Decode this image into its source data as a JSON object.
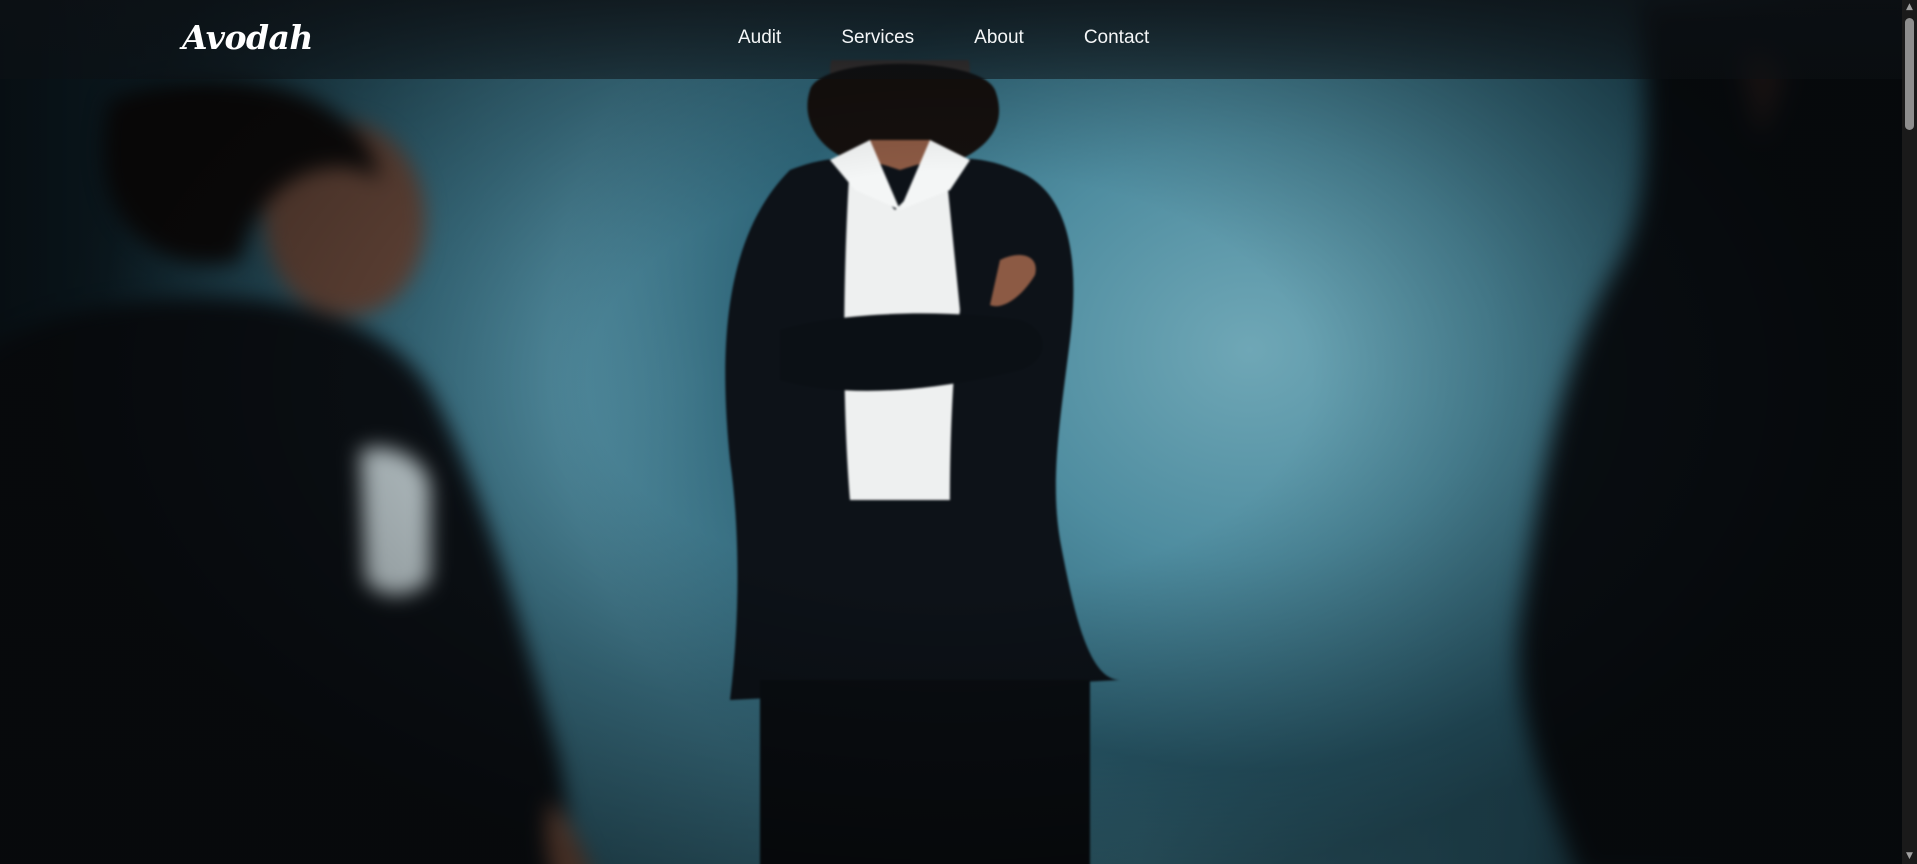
{
  "brand": {
    "logo_text": "Avodah"
  },
  "nav": {
    "items": [
      {
        "label": "Audit"
      },
      {
        "label": "Services"
      },
      {
        "label": "About"
      },
      {
        "label": "Contact"
      }
    ]
  },
  "hero": {
    "image_subject": "three women in dark blazers against a teal wall",
    "colors": {
      "wall": "#4b8ea2",
      "blazer": "#0c1218",
      "shirt": "#eef0f0"
    }
  },
  "scrollbar": {
    "up_icon": "triangle-up-icon",
    "down_icon": "triangle-down-icon",
    "position": 0.0
  }
}
